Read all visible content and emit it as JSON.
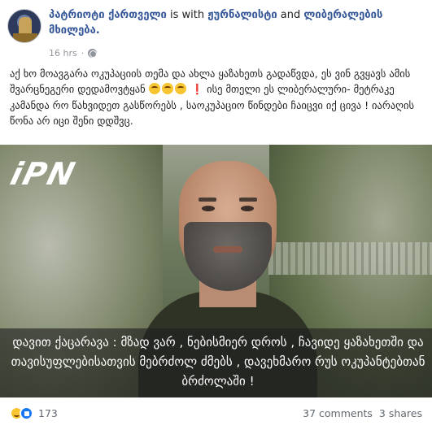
{
  "post": {
    "author": "პატრიოტი ქართველი",
    "with_text": "is with",
    "tagged_1": "ჟურნალისტი",
    "and_text": "and",
    "tagged_2": "ლიბერალების მხილება.",
    "time": "16 hrs",
    "privacy_icon": "globe-icon",
    "text_part1": "აქ ხო მოავგარა ოკუპაციის თემა და ახლა ყაზახეთს გადაწვდა, ეს ვინ გვყავს ამის შვარცნეგერი დედამოვტყან",
    "text_part2": "ისე მთელი ეს ლიბერალური- მეტრაკე კამანდა რო წახვიდეთ გასწორებს , საოკუპაციო წინდები ჩაიცვი იქ ცივა ! იარაღის წონა არ იცი შენი დდშვც."
  },
  "photo": {
    "logo": "iPN",
    "caption": "დავით ქაცარავა : მზად ვარ , ნებისმიერ დროს , ჩავიდე ყაზახეთში და თავისუფლებისათვის მებრძოლ ძმებს , დავეხმარო რუს ოკუპანტებთან ბრძოლაში !"
  },
  "footer": {
    "reaction_icons": [
      "haha-icon",
      "like-icon"
    ],
    "reaction_count": "173",
    "comments": "37 comments",
    "shares": "3 shares"
  },
  "colors": {
    "link": "#365899",
    "meta": "#90949c",
    "counts": "#606770"
  }
}
